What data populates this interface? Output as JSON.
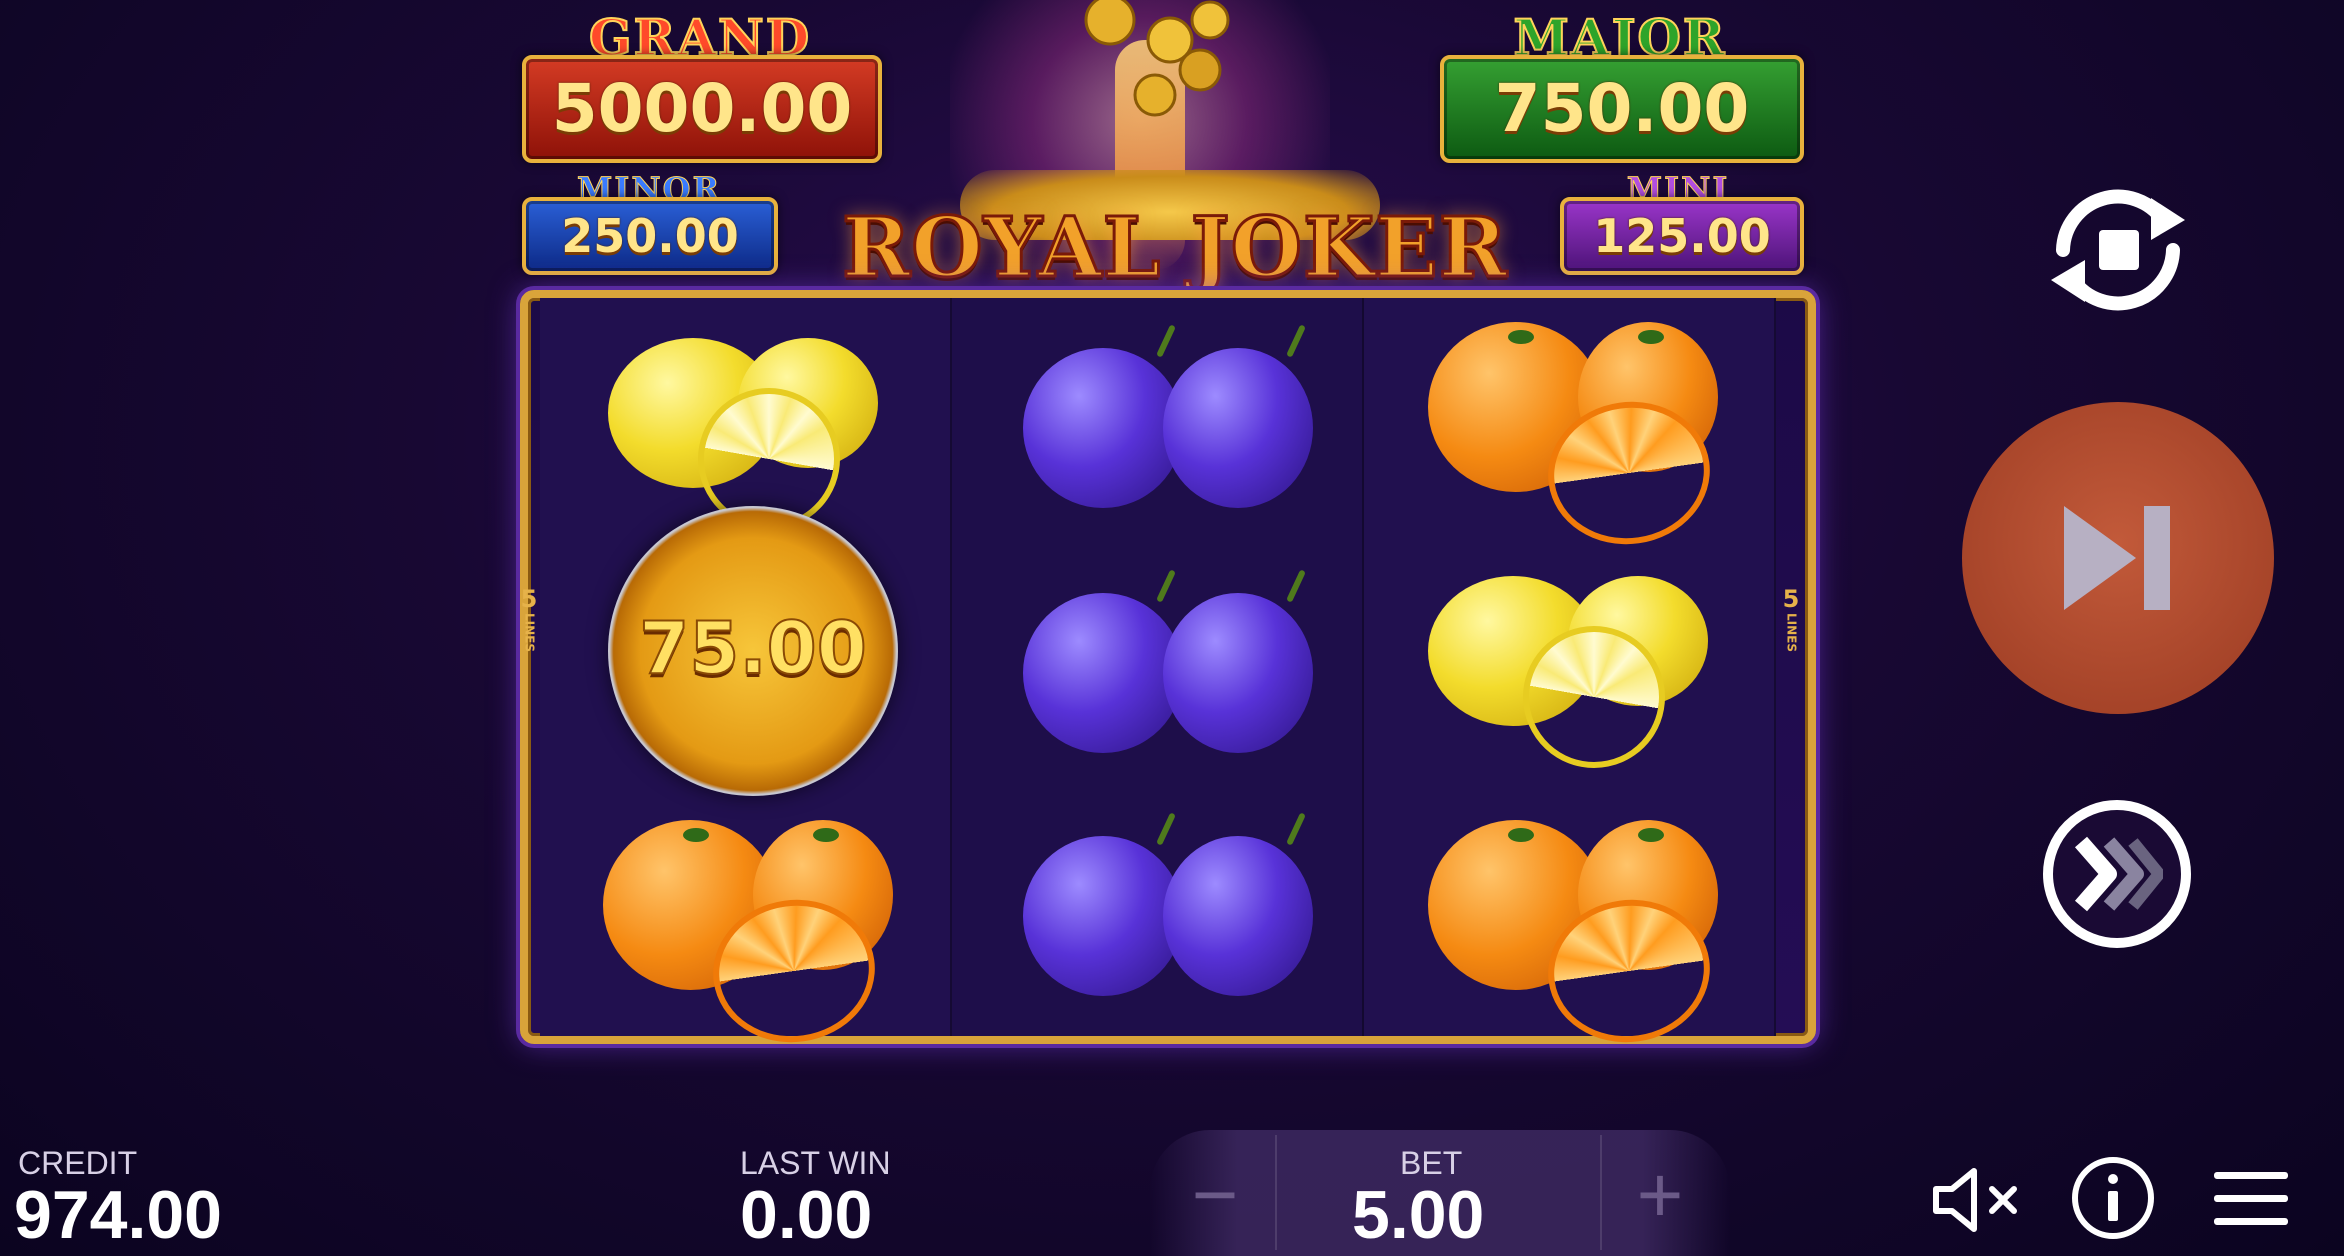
{
  "jackpots": {
    "grand": {
      "label": "GRAND",
      "value": "5000.00"
    },
    "major": {
      "label": "MAJOR",
      "value": "750.00"
    },
    "minor": {
      "label": "MINOR",
      "value": "250.00"
    },
    "mini": {
      "label": "MINI",
      "value": "125.00"
    }
  },
  "game": {
    "title": "ROYAL JOKER"
  },
  "reels": {
    "lines_left": {
      "number": "5",
      "text": "LINES"
    },
    "lines_right": {
      "number": "5",
      "text": "LINES"
    },
    "columns": [
      [
        "lemon",
        "coin",
        "orange"
      ],
      [
        "plum",
        "plum",
        "plum"
      ],
      [
        "orange",
        "lemon",
        "orange"
      ]
    ],
    "coin_value": "75.00"
  },
  "controls": {
    "autoplay_icon": "autoplay-icon",
    "spin_icon": "skip-next-icon",
    "turbo_icon": "fast-forward-icon"
  },
  "bottom_bar": {
    "credit_label": "CREDIT",
    "credit_value": "974.00",
    "last_win_label": "LAST WIN",
    "last_win_value": "0.00",
    "bet_label": "BET",
    "bet_value": "5.00",
    "minus": "−",
    "plus": "+"
  },
  "colors": {
    "spin": "#9b3b22",
    "frame": "#d9a43a",
    "background": "#180833"
  }
}
